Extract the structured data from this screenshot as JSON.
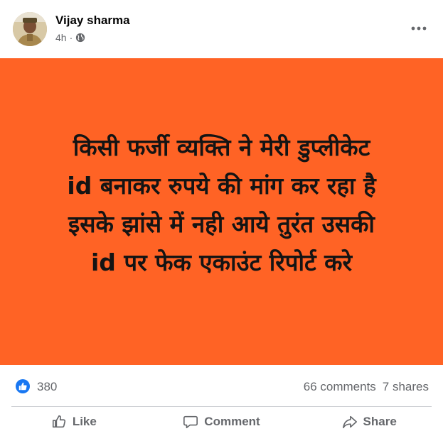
{
  "post": {
    "author": "Vijay sharma",
    "time": "4h",
    "meta_separator": "·",
    "privacy_icon": "globe-icon",
    "more_icon": "more-options-icon",
    "image_text_lines": [
      "किसी फर्जी व्यक्ति ने मेरी डुप्लीकेट",
      "id बनाकर रुपये की मांग कर रहा है",
      "इसके झांसे में नही आये तुरंत उसकी",
      "id पर फेक एकाउंट रिपोर्ट करे"
    ],
    "image_background": "#ff6325"
  },
  "stats": {
    "reaction_icon": "like-reaction-icon",
    "reactions": "380",
    "comments": "66 comments",
    "shares": "7 shares"
  },
  "actions": {
    "like": "Like",
    "comment": "Comment",
    "share": "Share"
  },
  "colors": {
    "accent": "#1877f2",
    "muted_text": "#65676b"
  }
}
